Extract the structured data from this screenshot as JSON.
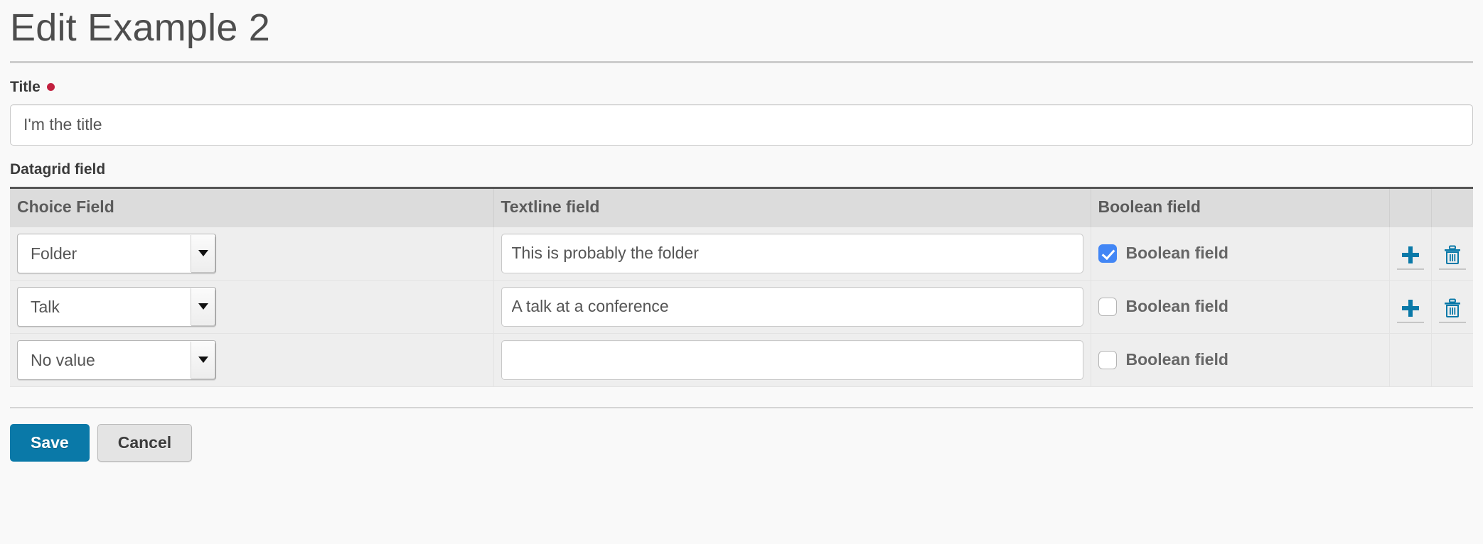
{
  "header": {
    "title": "Edit Example 2"
  },
  "title_field": {
    "label": "Title",
    "required": true,
    "value": "I'm the title",
    "placeholder": ""
  },
  "datagrid": {
    "label": "Datagrid field",
    "columns": [
      {
        "key": "choice",
        "label": "Choice Field"
      },
      {
        "key": "textline",
        "label": "Textline field"
      },
      {
        "key": "boolean",
        "label": "Boolean field"
      },
      {
        "key": "add",
        "label": ""
      },
      {
        "key": "remove",
        "label": ""
      }
    ],
    "choice_options": [
      "No value",
      "Folder",
      "Talk"
    ],
    "rows": [
      {
        "choice": "Folder",
        "textline": "This is probably the folder",
        "boolean_label": "Boolean field",
        "boolean_checked": true,
        "has_add": true,
        "has_remove": true,
        "add_icon": "plus-icon",
        "remove_icon": "trash-icon"
      },
      {
        "choice": "Talk",
        "textline": "A talk at a conference",
        "boolean_label": "Boolean field",
        "boolean_checked": false,
        "has_add": true,
        "has_remove": true,
        "add_icon": "plus-icon",
        "remove_icon": "trash-icon"
      },
      {
        "choice": "No value",
        "textline": "",
        "boolean_label": "Boolean field",
        "boolean_checked": false,
        "has_add": false,
        "has_remove": false,
        "add_icon": "",
        "remove_icon": ""
      }
    ]
  },
  "footer": {
    "save_label": "Save",
    "cancel_label": "Cancel"
  },
  "colors": {
    "accent_blue": "#0a79a8",
    "checkbox_blue": "#4286f5",
    "required_red": "#c2203f",
    "page_bg": "#f9f9f9",
    "header_row_bg": "#dcdcdc",
    "row_bg": "#eeeeee"
  }
}
